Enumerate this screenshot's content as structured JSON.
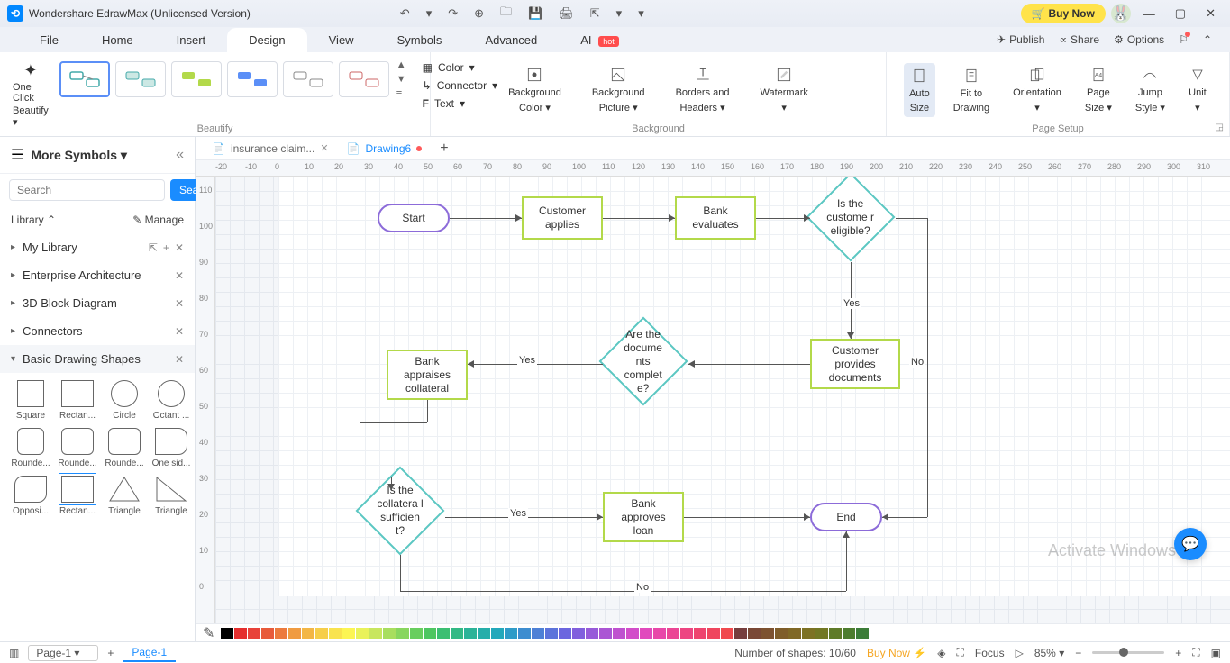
{
  "app": {
    "title": "Wondershare EdrawMax (Unlicensed Version)",
    "buy_now": "Buy Now"
  },
  "menus": {
    "file": "File",
    "home": "Home",
    "insert": "Insert",
    "design": "Design",
    "view": "View",
    "symbols": "Symbols",
    "advanced": "Advanced",
    "ai": "AI",
    "ai_tag": "hot",
    "publish": "Publish",
    "share": "Share",
    "options": "Options"
  },
  "ribbon": {
    "one_click_1": "One Click",
    "one_click_2": "Beautify",
    "color": "Color",
    "connector": "Connector",
    "text": "Text",
    "beautify_label": "Beautify",
    "bg_color_1": "Background",
    "bg_color_2": "Color",
    "bg_pic_1": "Background",
    "bg_pic_2": "Picture",
    "borders_1": "Borders and",
    "borders_2": "Headers",
    "watermark": "Watermark",
    "background_label": "Background",
    "auto_size_1": "Auto",
    "auto_size_2": "Size",
    "fit_1": "Fit to",
    "fit_2": "Drawing",
    "orientation": "Orientation",
    "page_size_1": "Page",
    "page_size_2": "Size",
    "jump_1": "Jump",
    "jump_2": "Style",
    "unit": "Unit",
    "page_setup_label": "Page Setup"
  },
  "left": {
    "more_symbols": "More Symbols",
    "search_ph": "Search",
    "search_btn": "Search",
    "library": "Library",
    "manage": "Manage",
    "categories": {
      "my_library": "My Library",
      "enterprise": "Enterprise Architecture",
      "three_d": "3D Block Diagram",
      "connectors": "Connectors",
      "basic": "Basic Drawing Shapes"
    },
    "shapes": {
      "square": "Square",
      "rectangle": "Rectan...",
      "circle": "Circle",
      "octant": "Octant ...",
      "rounded1": "Rounde...",
      "rounded2": "Rounde...",
      "rounded3": "Rounde...",
      "oneside": "One sid...",
      "opposite": "Opposi...",
      "rect2": "Rectan...",
      "tri1": "Triangle",
      "tri2": "Triangle"
    }
  },
  "tabs": {
    "tab1": "insurance claim...",
    "tab2": "Drawing6"
  },
  "ruler_h": [
    "-20",
    "-10",
    "0",
    "10",
    "20",
    "30",
    "40",
    "50",
    "60",
    "70",
    "80",
    "90",
    "100",
    "110",
    "120",
    "130",
    "140",
    "150",
    "160",
    "170",
    "180",
    "190",
    "200",
    "210",
    "220",
    "230",
    "240",
    "250",
    "260",
    "270",
    "280",
    "290",
    "300",
    "310"
  ],
  "ruler_v": [
    "110",
    "100",
    "90",
    "80",
    "70",
    "60",
    "50",
    "40",
    "30",
    "20",
    "10",
    "0"
  ],
  "flow": {
    "start": "Start",
    "cust_applies": "Customer applies",
    "bank_eval": "Bank evaluates",
    "is_eligible": "Is the custome r eligible?",
    "cust_docs": "Customer provides documents",
    "docs_complete": "Are the docume nts complet e?",
    "bank_appraises": "Bank appraises collateral",
    "coll_sufficient": "Is the collatera l sufficien t?",
    "bank_approves": "Bank approves loan",
    "end": "End",
    "yes": "Yes",
    "no": "No"
  },
  "color_palette": [
    "#000000",
    "#e52e2e",
    "#e8423a",
    "#e85a3a",
    "#ec7a3d",
    "#f09b41",
    "#f3b645",
    "#f6ce4a",
    "#f9e34e",
    "#fcf553",
    "#e9f25a",
    "#c8e65e",
    "#a8de5e",
    "#88d65e",
    "#68ce5e",
    "#4ec661",
    "#3cbf72",
    "#32b985",
    "#2bb398",
    "#26aeaa",
    "#22a8bb",
    "#2e9bc8",
    "#3d8dd0",
    "#4d80d6",
    "#5c73db",
    "#6c66df",
    "#815fdd",
    "#975ad9",
    "#ab55d4",
    "#bf51cf",
    "#d24dc9",
    "#e14abd",
    "#e848a9",
    "#eb4695",
    "#ed4582",
    "#ee456f",
    "#ef465e",
    "#f0494e",
    "#763e3e",
    "#7a4836",
    "#7d5230",
    "#7f5d2a",
    "#806826",
    "#7d7224",
    "#727824",
    "#5f7b28",
    "#4d7d2e",
    "#3c7d38"
  ],
  "status": {
    "page_dropdown": "Page-1",
    "page_tab": "Page-1",
    "shapes_count": "Number of shapes: 10/60",
    "buy_now": "Buy Now",
    "focus": "Focus",
    "zoom": "85%"
  },
  "watermark_text": "Activate Windows"
}
